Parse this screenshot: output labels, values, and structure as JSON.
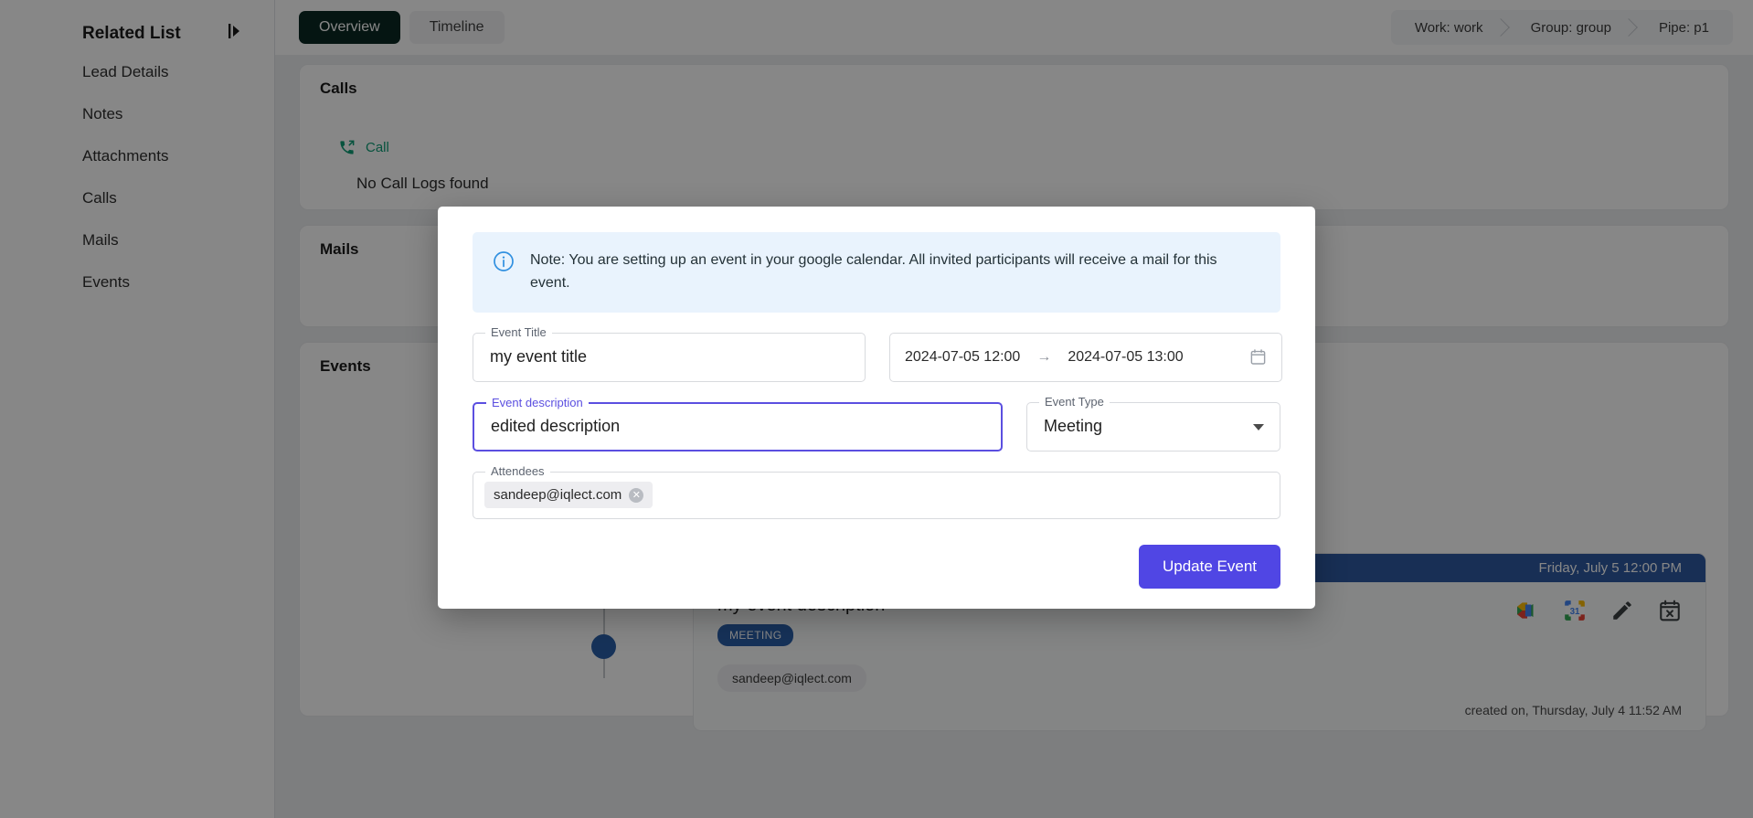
{
  "sidebar": {
    "title": "Related List",
    "collapse_icon": "collapse-panel-icon",
    "items": [
      {
        "label": "Lead Details"
      },
      {
        "label": "Notes"
      },
      {
        "label": "Attachments"
      },
      {
        "label": "Calls"
      },
      {
        "label": "Mails"
      },
      {
        "label": "Events"
      }
    ]
  },
  "topbar": {
    "tabs": [
      {
        "label": "Overview",
        "active": true
      },
      {
        "label": "Timeline",
        "active": false
      }
    ],
    "breadcrumb": [
      {
        "label": "Work: work"
      },
      {
        "label": "Group: group"
      },
      {
        "label": "Pipe: p1"
      }
    ]
  },
  "calls_section": {
    "title": "Calls",
    "call_link": "Call",
    "call_icon": "phone-outgoing-icon",
    "empty_text": "No Call Logs found"
  },
  "mails_section": {
    "title": "Mails"
  },
  "events_section": {
    "title": "Events",
    "event": {
      "date_header": "Friday, July 5 12:00 PM",
      "description": "my event description",
      "badge": "MEETING",
      "attendee": "sandeep@iqlect.com",
      "created": "created on, Thursday, July 4 11:52 AM",
      "icons": [
        {
          "name": "google-meet-icon"
        },
        {
          "name": "google-calendar-icon"
        },
        {
          "name": "edit-pencil-icon"
        },
        {
          "name": "cancel-event-icon"
        }
      ]
    }
  },
  "modal": {
    "note_icon": "info-circle-icon",
    "note": "Note: You are setting up an event in your google calendar. All invited participants will receive a mail for this event.",
    "event_title": {
      "label": "Event Title",
      "value": "my event title",
      "placeholder": "Event Title"
    },
    "date_range": {
      "start": "2024-07-05 12:00",
      "arrow": "→",
      "end": "2024-07-05 13:00",
      "calendar_icon": "calendar-icon"
    },
    "event_description": {
      "label": "Event description",
      "value": "edited description",
      "placeholder": "Event description",
      "focused": true
    },
    "event_type": {
      "label": "Event Type",
      "value": "Meeting",
      "caret_icon": "chevron-down-icon"
    },
    "attendees": {
      "label": "Attendees",
      "chip": "sandeep@iqlect.com",
      "chip_remove_icon": "close-circle-icon"
    },
    "submit_label": "Update Event"
  },
  "colors": {
    "accent": "#5046e4",
    "focus": "#5b4fe0",
    "tab_active_bg": "#0b2823",
    "note_bg": "#e9f3fd",
    "event_blue": "#2a5fa8",
    "call_green": "#0f9d76"
  }
}
